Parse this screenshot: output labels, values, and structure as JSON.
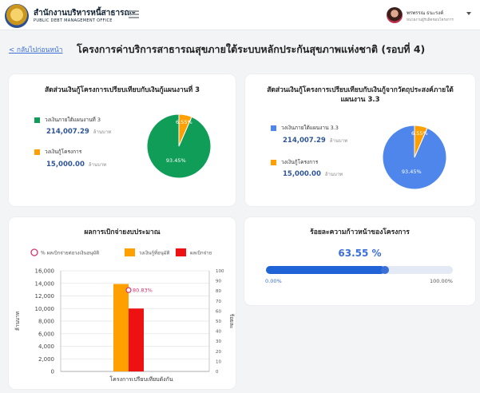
{
  "header": {
    "org_name_th": "สำนักงานบริหารหนี้สาธารณะ",
    "org_name_en": "PUBLIC DEBT MANAGEMENT OFFICE",
    "user_name": "พรพรรณ ธนะรงค์",
    "user_role": "หน่วยงานผู้รับผิดชอบโครงการ"
  },
  "page": {
    "back_label": "< กลับไปก่อนหน้า",
    "title": "โครงการค่าบริการสาธารณสุขภายใต้ระบบหลักประกันสุขภาพแห่งชาติ (รอบที่ 4)"
  },
  "card1": {
    "title": "สัดส่วนเงินกู้โครงการเปรียบเทียบกับเงินกู้แผนงานที่ 3",
    "legend": [
      {
        "label": "วงเงินภายใต้แผนงานที่ 3",
        "value": "214,007.29",
        "unit": "ล้านบาท",
        "color": "#0f9d58"
      },
      {
        "label": "วงเงินกู้โครงการ",
        "value": "15,000.00",
        "unit": "ล้านบาท",
        "color": "#ff9f00"
      }
    ]
  },
  "card2": {
    "title_line1": "สัดส่วนเงินกู้โครงการเปรียบเทียบกับเงินกู้จากวัตถุประสงค์ภายใต้",
    "title_line2": "แผนงาน 3.3",
    "legend": [
      {
        "label": "วงเงินภายใต้แผนงาน 3.3",
        "value": "214,007.29",
        "unit": "ล้านบาท",
        "color": "#4f86ec"
      },
      {
        "label": "วงเงินกู้โครงการ",
        "value": "15,000.00",
        "unit": "ล้านบาท",
        "color": "#ff9f00"
      }
    ]
  },
  "card3": {
    "title": "ผลการเบิกจ่ายงบประมาณ"
  },
  "card4": {
    "title": "ร้อยละความก้าวหน้าของโครงการ",
    "progress_label": "63.55 %",
    "progress_value": 63.55,
    "min_label": "0.00%",
    "max_label": "100.00%"
  },
  "chart_data": [
    {
      "type": "pie",
      "labels": [
        "วงเงินภายใต้แผนงานที่ 3",
        "วงเงินกู้โครงการ"
      ],
      "values": [
        93.45,
        6.55
      ],
      "value_labels": [
        "93.45%",
        "6.55%"
      ],
      "colors": [
        "#0f9d58",
        "#ff9f00"
      ]
    },
    {
      "type": "pie",
      "labels": [
        "วงเงินภายใต้แผนงาน 3.3",
        "วงเงินกู้โครงการ"
      ],
      "values": [
        93.45,
        6.55
      ],
      "value_labels": [
        "93.45%",
        "6.55%"
      ],
      "colors": [
        "#4f86ec",
        "#ff9f00"
      ]
    },
    {
      "type": "bar",
      "title": "ผลการเบิกจ่ายงบประมาณ",
      "categories": [
        "โครงการเปรียบเทียบดังกัน"
      ],
      "series": [
        {
          "name": "วงเงินกู้ที่อนุมัติ",
          "values": [
            13900
          ],
          "color": "#ff9f00",
          "axis": "left"
        },
        {
          "name": "ผลเบิกจ่าย",
          "values": [
            10000
          ],
          "color": "#ee1111",
          "axis": "left"
        },
        {
          "name": "% ผลเบิกจ่ายต่อวงเงินอนุมัติ",
          "values": [
            80.83
          ],
          "value_label": "80.83%",
          "color": "#d6336c",
          "axis": "right",
          "marker": "circle"
        }
      ],
      "ylabel": "ล้านบาท",
      "y2label": "ร้อยละ",
      "ylim": [
        0,
        16000
      ],
      "y2lim": [
        0,
        100
      ],
      "yticks": [
        "0",
        "2,000",
        "4,000",
        "6,000",
        "8,000",
        "10,000",
        "12,000",
        "14,000",
        "16,000"
      ],
      "y2ticks": [
        "0",
        "10",
        "20",
        "30",
        "40",
        "50",
        "60",
        "70",
        "80",
        "90",
        "100"
      ],
      "legend_position": "top"
    }
  ]
}
